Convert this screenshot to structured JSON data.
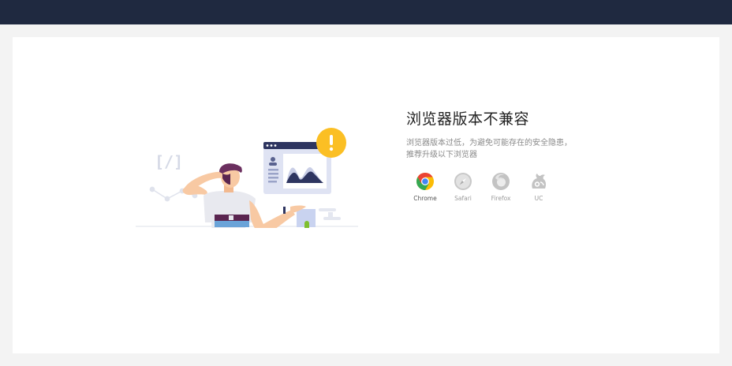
{
  "page": {
    "title": "浏览器版本不兼容",
    "description_line1": "浏览器版本过低，为避免可能存在的安全隐患，",
    "description_line2": "推荐升级以下浏览器"
  },
  "browsers": [
    {
      "label": "Chrome",
      "icon": "chrome-icon",
      "color": "#e8453c"
    },
    {
      "label": "Safari",
      "icon": "safari-icon",
      "color": "#bdbdbd"
    },
    {
      "label": "Firefox",
      "icon": "firefox-icon",
      "color": "#bdbdbd"
    },
    {
      "label": "UC",
      "icon": "uc-icon",
      "color": "#bdbdbd"
    }
  ],
  "illustration": {
    "code_glyph": "[/]",
    "warning_mark": "!",
    "accent_color": "#fbbf24",
    "navy_color": "#2e3560"
  }
}
